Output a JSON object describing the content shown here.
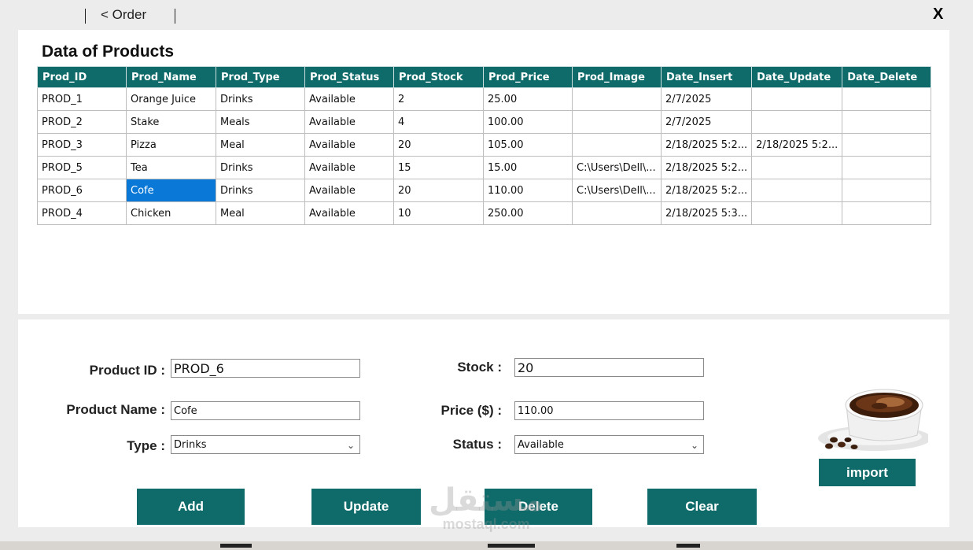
{
  "nav": {
    "back_label": "< Order",
    "close_label": "X"
  },
  "grid": {
    "title": "Data of Products",
    "columns": [
      "Prod_ID",
      "Prod_Name",
      "Prod_Type",
      "Prod_Status",
      "Prod_Stock",
      "Prod_Price",
      "Prod_Image",
      "Date_Insert",
      "Date_Update",
      "Date_Delete"
    ],
    "rows": [
      [
        "PROD_1",
        "Orange Juice",
        "Drinks",
        "Available",
        "2",
        "25.00",
        "",
        "2/7/2025",
        "",
        ""
      ],
      [
        "PROD_2",
        "Stake",
        "Meals",
        "Available",
        "4",
        "100.00",
        "",
        "2/7/2025",
        "",
        ""
      ],
      [
        "PROD_3",
        "Pizza",
        "Meal",
        "Available",
        "20",
        "105.00",
        "",
        "2/18/2025 5:2...",
        "2/18/2025 5:2...",
        ""
      ],
      [
        "PROD_5",
        "Tea",
        "Drinks",
        "Available",
        "15",
        "15.00",
        "C:\\Users\\Dell\\...",
        "2/18/2025 5:2...",
        "",
        ""
      ],
      [
        "PROD_6",
        "Cofe",
        "Drinks",
        "Available",
        "20",
        "110.00",
        "C:\\Users\\Dell\\...",
        "2/18/2025 5:2...",
        "",
        ""
      ],
      [
        "PROD_4",
        "Chicken",
        "Meal",
        "Available",
        "10",
        "250.00",
        "",
        "2/18/2025 5:3...",
        "",
        ""
      ]
    ],
    "selected_row": 4,
    "selected_col": 1
  },
  "form": {
    "product_id_label": "Product ID :",
    "product_id_value": "PROD_6",
    "product_name_label": "Product Name :",
    "product_name_value": "Cofe",
    "type_label": "Type :",
    "type_value": "Drinks",
    "stock_label": "Stock :",
    "stock_value": "20",
    "price_label": "Price ($) :",
    "price_value": "110.00",
    "status_label": "Status :",
    "status_value": "Available"
  },
  "buttons": {
    "add": "Add",
    "update": "Update",
    "delete": "Delete",
    "clear": "Clear",
    "import": "import"
  },
  "watermark": {
    "arabic": "مستقل",
    "latin": "mostaql.com"
  },
  "colors": {
    "accent": "#0f6a6a",
    "selection": "#0a78d7"
  }
}
